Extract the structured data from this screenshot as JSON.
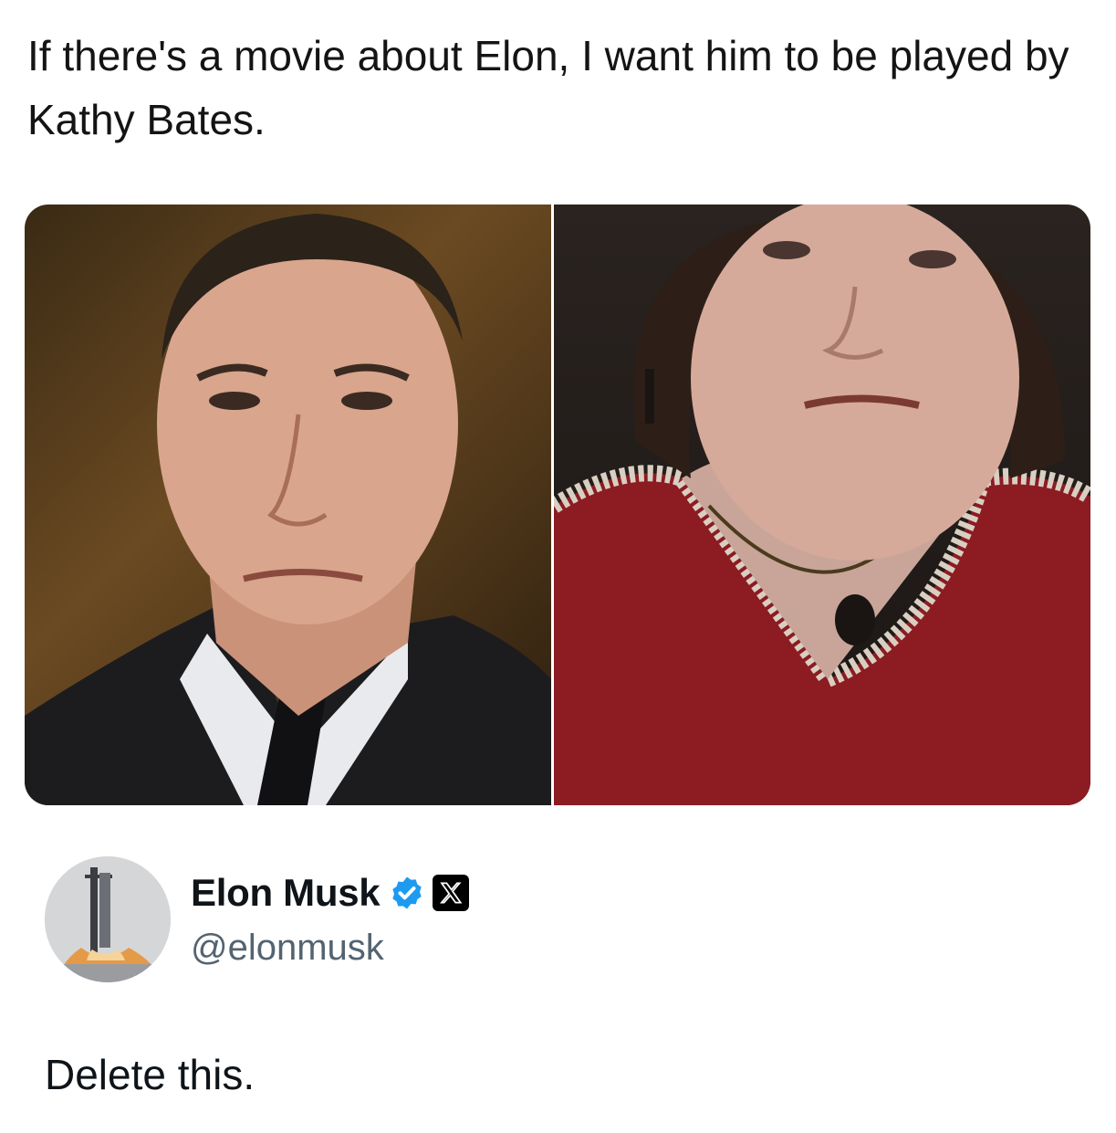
{
  "post": {
    "text": "If there's a movie about Elon, I want him to be played by Kathy Bates."
  },
  "media": {
    "left_icon": "portrait-man-photo",
    "right_icon": "portrait-woman-photo"
  },
  "author": {
    "display_name": "Elon Musk",
    "handle": "@elonmusk",
    "avatar_icon": "rocket-launch-avatar",
    "verified_icon": "verified-badge-icon",
    "affiliation_icon": "x-logo-icon",
    "verified_color": "#1d9bf0"
  },
  "reply": {
    "text": "Delete this."
  }
}
